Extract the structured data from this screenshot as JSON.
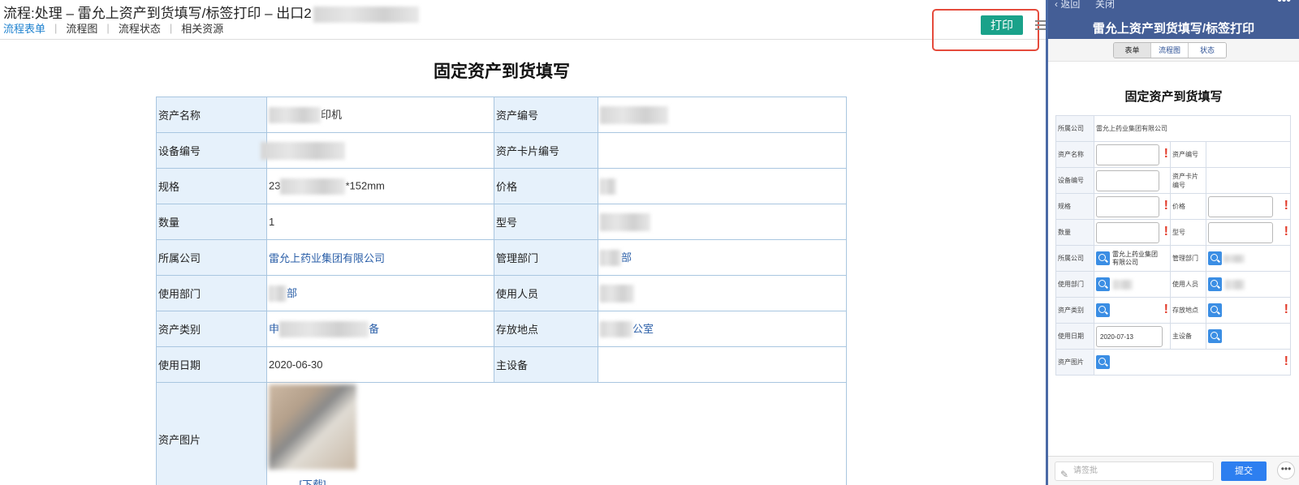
{
  "desktop": {
    "title_prefix": "流程:处理 – 雷允上资产到货填写/标签打印 – 出口2",
    "tabs": [
      "流程表单",
      "流程图",
      "流程状态",
      "相关资源"
    ],
    "print_label": "打印",
    "form_title": "固定资产到货填写",
    "rows": {
      "asset_name_label": "资产名称",
      "asset_name_value": "印机",
      "asset_no_label": "资产编号",
      "device_no_label": "设备编号",
      "card_no_label": "资产卡片编号",
      "spec_label": "规格",
      "spec_prefix": "23",
      "spec_suffix": "*152mm",
      "price_label": "价格",
      "qty_label": "数量",
      "qty_value": "1",
      "model_label": "型号",
      "company_label": "所属公司",
      "company_value": "雷允上药业集团有限公司",
      "dept_label": "管理部门",
      "dept_value": "部",
      "use_dept_label": "使用部门",
      "use_dept_value": "部",
      "user_label": "使用人员",
      "category_label": "资产类别",
      "category_prefix": "申",
      "category_suffix": "备",
      "location_label": "存放地点",
      "location_value": "公室",
      "use_date_label": "使用日期",
      "use_date_value": "2020-06-30",
      "main_device_label": "主设备",
      "image_label": "资产图片",
      "download_label": "[下载]"
    }
  },
  "mobile": {
    "back_label": "返回",
    "close_label": "关闭",
    "more": "•••",
    "title": "雷允上资产到货填写/标签打印",
    "segments": [
      "表单",
      "流程图",
      "状态"
    ],
    "form_title": "固定资产到货填写",
    "company_row_label": "所属公司",
    "company_row_value": "雷允上药业集团有限公司",
    "labels": {
      "asset_name": "资产名称",
      "asset_no": "资产编号",
      "device_no": "设备编号",
      "card_no": "资产卡片编号",
      "spec": "规格",
      "price": "价格",
      "qty": "数量",
      "model": "型号",
      "company": "所属公司",
      "dept": "管理部门",
      "use_dept": "使用部门",
      "user": "使用人员",
      "category": "资产类别",
      "location": "存放地点",
      "use_date": "使用日期",
      "main_device": "主设备",
      "image": "资产图片"
    },
    "company_value": "雷允上药业集团有限公司",
    "use_date_value": "2020-07-13",
    "required_mark": "!",
    "comment_placeholder": "请签批",
    "submit_label": "提交",
    "footer_more": "•••"
  },
  "colors": {
    "print_button": "#1aa28a",
    "highlight_box": "#e54b3c",
    "mobile_header": "#445e96",
    "submit_button": "#2d7ff0",
    "required": "#e23c2b"
  }
}
